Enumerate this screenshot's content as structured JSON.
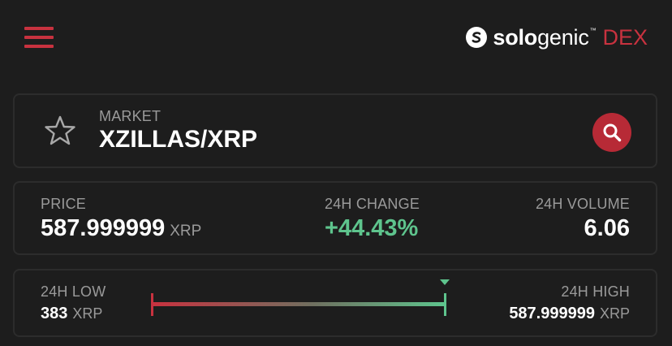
{
  "header": {
    "menu_icon": "hamburger-menu-icon",
    "brand_mark_letter": "s",
    "brand_bold": "solo",
    "brand_light": "genic",
    "brand_tm": "™",
    "brand_suffix": "DEX",
    "colors": {
      "accent": "#c8323f",
      "positive": "#5ec48d",
      "background": "#1d1d1d"
    }
  },
  "market": {
    "label": "MARKET",
    "pair": "XZILLAS/XRP",
    "favorite_icon": "star-outline-icon",
    "search_icon": "search-icon"
  },
  "stats": {
    "price_label": "PRICE",
    "price_value": "587.999999",
    "price_unit": "XRP",
    "change_label": "24H CHANGE",
    "change_value": "+44.43%",
    "volume_label": "24H VOLUME",
    "volume_value": "6.06"
  },
  "range": {
    "low_label": "24H LOW",
    "low_value": "383",
    "low_unit": "XRP",
    "high_label": "24H HIGH",
    "high_value": "587.999999",
    "high_unit": "XRP",
    "current_position_fraction": 1.0
  }
}
